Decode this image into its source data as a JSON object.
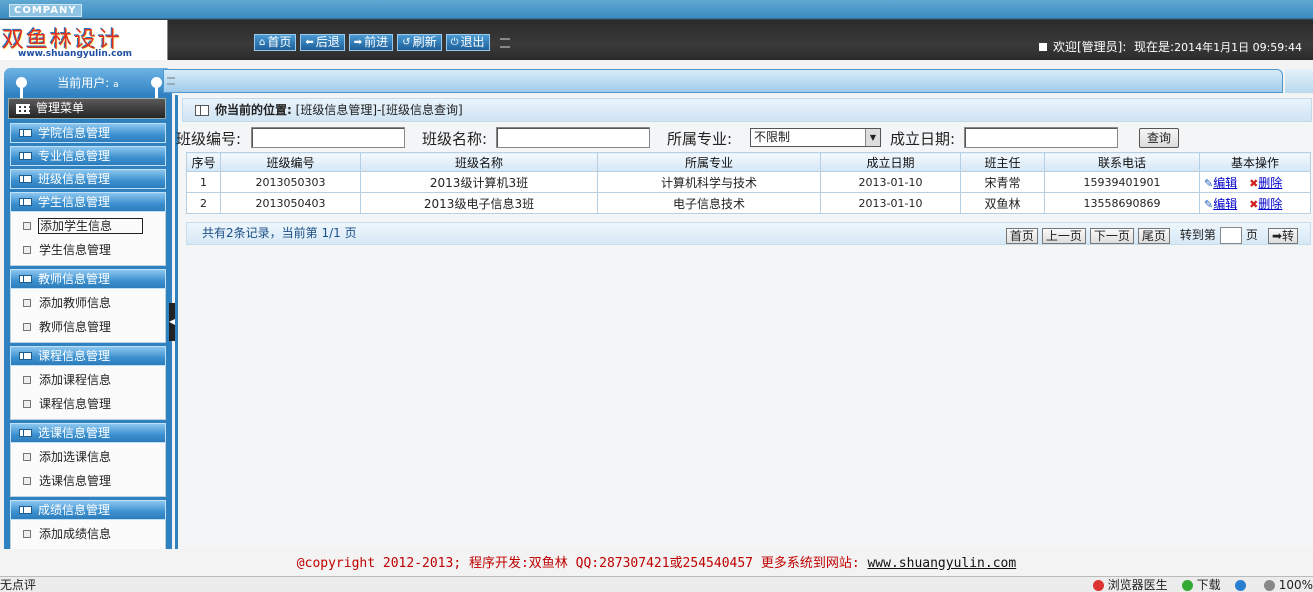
{
  "header": {
    "company": "COMPANY",
    "logo_text": "双鱼林设计",
    "logo_url": "www.shuangyulin.com",
    "nav": [
      {
        "label": "首页",
        "icon": "home-icon",
        "glyph": "⌂"
      },
      {
        "label": "后退",
        "icon": "back-icon",
        "glyph": "⬅"
      },
      {
        "label": "前进",
        "icon": "forward-icon",
        "glyph": "➡"
      },
      {
        "label": "刷新",
        "icon": "refresh-icon",
        "glyph": "↺"
      },
      {
        "label": "退出",
        "icon": "power-icon",
        "glyph": "⏻"
      }
    ],
    "welcome": "欢迎[管理员]:",
    "time_label": "现在是:",
    "time_value": "2014年1月1日 09:59:44"
  },
  "sidebar": {
    "current_user_label": "当前用户:",
    "current_user_value": "a",
    "menu_title": "管理菜单",
    "groups": [
      {
        "title": "学院信息管理",
        "items": []
      },
      {
        "title": "专业信息管理",
        "items": []
      },
      {
        "title": "班级信息管理",
        "items": []
      },
      {
        "title": "学生信息管理",
        "items": [
          "添加学生信息",
          "学生信息管理"
        ]
      },
      {
        "title": "教师信息管理",
        "items": [
          "添加教师信息",
          "教师信息管理"
        ]
      },
      {
        "title": "课程信息管理",
        "items": [
          "添加课程信息",
          "课程信息管理"
        ]
      },
      {
        "title": "选课信息管理",
        "items": [
          "添加选课信息",
          "选课信息管理"
        ]
      },
      {
        "title": "成绩信息管理",
        "items": [
          "添加成绩信息"
        ]
      }
    ]
  },
  "breadcrumb": {
    "label": "你当前的位置:",
    "path": "[班级信息管理]-[班级信息查询]"
  },
  "search": {
    "class_no_label": "班级编号:",
    "class_no_value": "",
    "class_name_label": "班级名称:",
    "class_name_value": "",
    "major_label": "所属专业:",
    "major_value": "不限制",
    "date_label": "成立日期:",
    "date_value": "",
    "button": "查询"
  },
  "table": {
    "headers": [
      "序号",
      "班级编号",
      "班级名称",
      "所属专业",
      "成立日期",
      "班主任",
      "联系电话",
      "基本操作"
    ],
    "rows": [
      [
        "1",
        "2013050303",
        "2013级计算机3班",
        "计算机科学与技术",
        "2013-01-10",
        "宋青常",
        "15939401901"
      ],
      [
        "2",
        "2013050403",
        "2013级电子信息3班",
        "电子信息技术",
        "2013-01-10",
        "双鱼林",
        "13558690869"
      ]
    ],
    "edit_label": "编辑",
    "delete_label": "删除"
  },
  "pager": {
    "info": "共有2条记录，当前第 1/1 页",
    "first": "首页",
    "prev": "上一页",
    "next": "下一页",
    "last": "尾页",
    "goto_label": "转到第",
    "page_suffix": "页",
    "go_button": "➡转"
  },
  "footer": {
    "text": "@copyright 2012-2013; 程序开发:双鱼林  QQ:287307421或254540457  更多系统到网站:",
    "link": "www.shuangyulin.com"
  },
  "statusbar": {
    "left": "无点评",
    "items": [
      "浏览器医生",
      "下载",
      "100%"
    ]
  },
  "colors": {
    "sidebar": "#2f82bf",
    "footer_text": "#c00000",
    "link": "#0000cc"
  }
}
